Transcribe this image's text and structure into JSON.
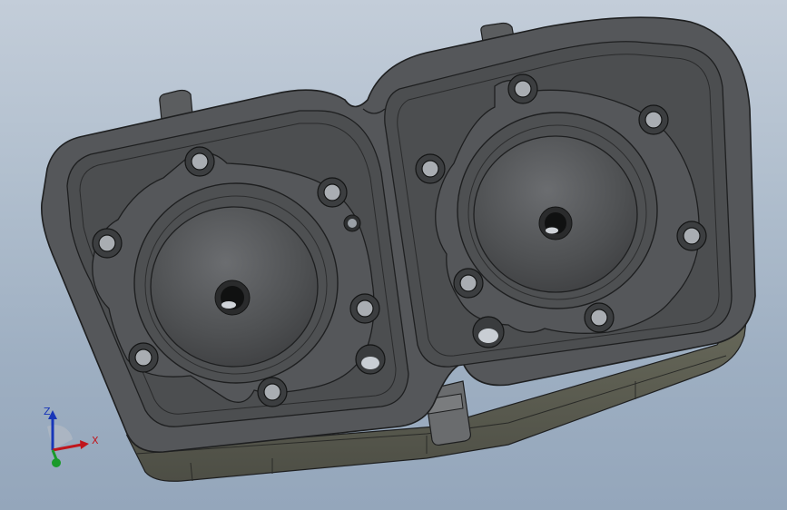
{
  "view": {
    "background_top": "#c3cdd9",
    "background_bottom": "#94a6bb",
    "model_color": "#505254",
    "model_edge_color": "#1e1f20"
  },
  "triad": {
    "x_label": "X",
    "z_label": "Z",
    "x_color": "#c0161d",
    "y_color": "#1a9a2a",
    "z_color": "#1836b8"
  }
}
